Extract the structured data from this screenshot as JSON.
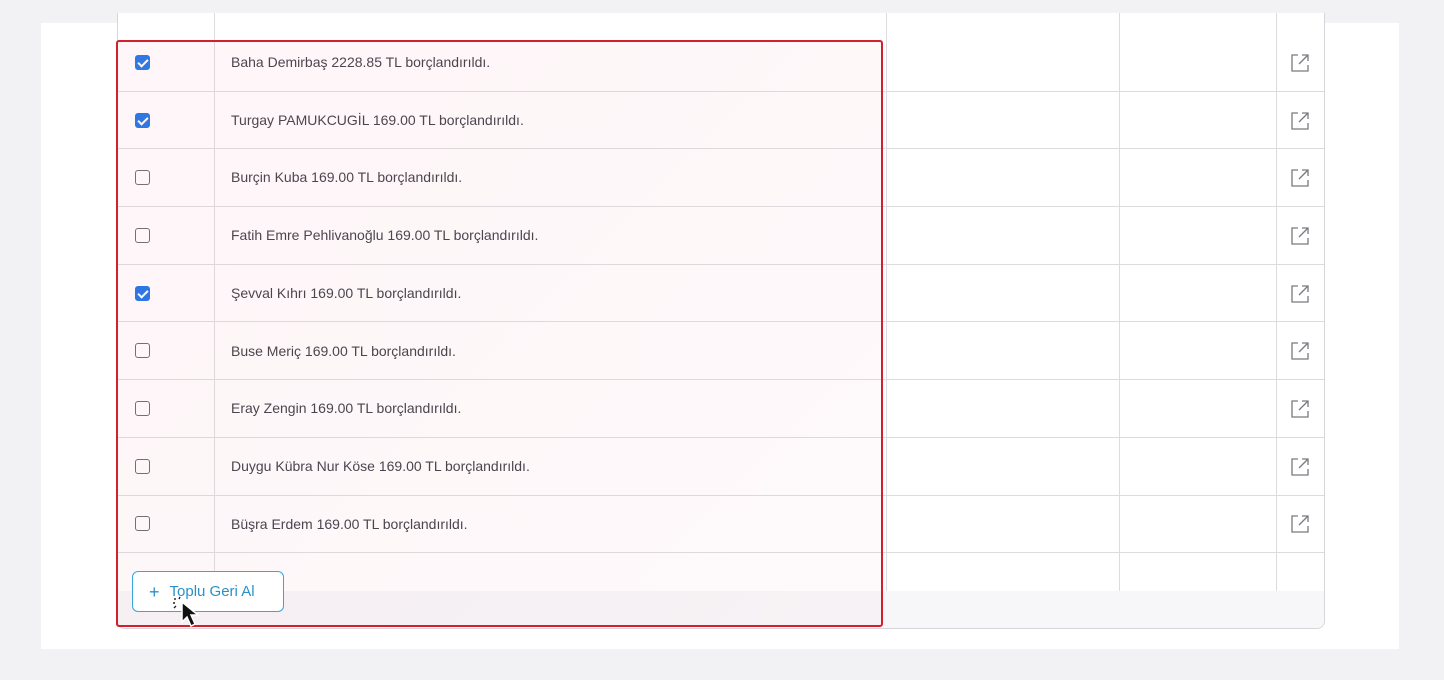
{
  "rows": [
    {
      "label": "Baha Demirbaş 2228.85 TL borçlandırıldı.",
      "checked": true
    },
    {
      "label": "Turgay PAMUKCUGİL 169.00 TL borçlandırıldı.",
      "checked": true
    },
    {
      "label": "Burçin Kuba 169.00 TL borçlandırıldı.",
      "checked": false
    },
    {
      "label": "Fatih Emre Pehlivanoğlu 169.00 TL borçlandırıldı.",
      "checked": false
    },
    {
      "label": "Şevval Kıhrı 169.00 TL borçlandırıldı.",
      "checked": true
    },
    {
      "label": "Buse Meriç 169.00 TL borçlandırıldı.",
      "checked": false
    },
    {
      "label": "Eray Zengin 169.00 TL borçlandırıldı.",
      "checked": false
    },
    {
      "label": "Duygu Kübra Nur Köse 169.00 TL borçlandırıldı.",
      "checked": false
    },
    {
      "label": "Büşra Erdem 169.00 TL borçlandırıldı.",
      "checked": false
    }
  ],
  "footer": {
    "bulk_revert_label": "Toplu Geri Al",
    "bulk_revert_icon": "plus-icon"
  },
  "row_action_icon": "external-link-icon",
  "colors": {
    "checkbox_checked": "#1a73e8",
    "button_accent": "#2b90c8",
    "highlight_border": "#d3202f"
  }
}
